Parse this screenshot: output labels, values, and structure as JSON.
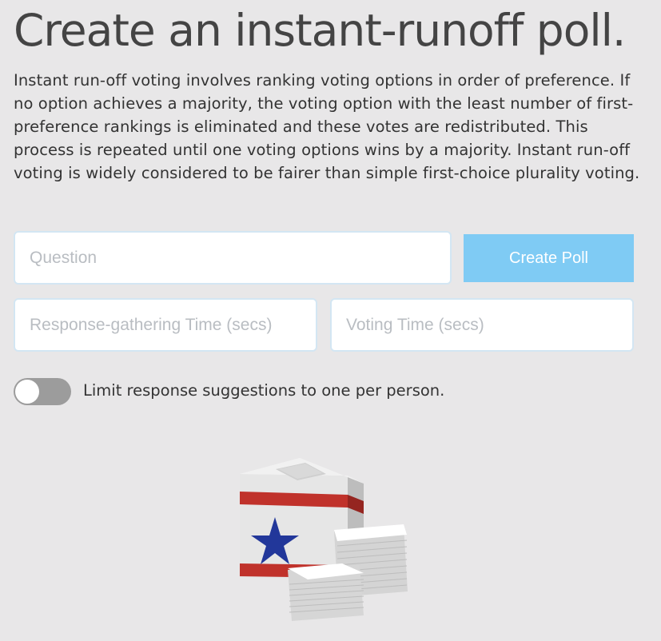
{
  "header": {
    "title": "Create an instant-runoff poll."
  },
  "description": "Instant run-off voting involves ranking voting options in order of preference. If no option achieves a majority, the voting option with the least number of first-preference rankings is eliminated and these votes are redistributed. This process is repeated until one voting options wins by a majority. Instant run-off voting is widely considered to be fairer than simple first-choice plurality voting.",
  "form": {
    "question": {
      "placeholder": "Question",
      "value": ""
    },
    "create_button_label": "Create Poll",
    "response_time": {
      "placeholder": "Response-gathering Time (secs)",
      "value": ""
    },
    "voting_time": {
      "placeholder": "Voting Time (secs)",
      "value": ""
    },
    "limit_toggle": {
      "label": "Limit response suggestions to one per person.",
      "checked": false
    }
  },
  "illustration": {
    "icon": "ballot-box-icon"
  },
  "colors": {
    "background": "#e8e7e8",
    "accent": "#7fcbf4",
    "toggle_off": "#9c9c9c",
    "stripe_red": "#c0322b",
    "star_blue": "#22379a"
  }
}
